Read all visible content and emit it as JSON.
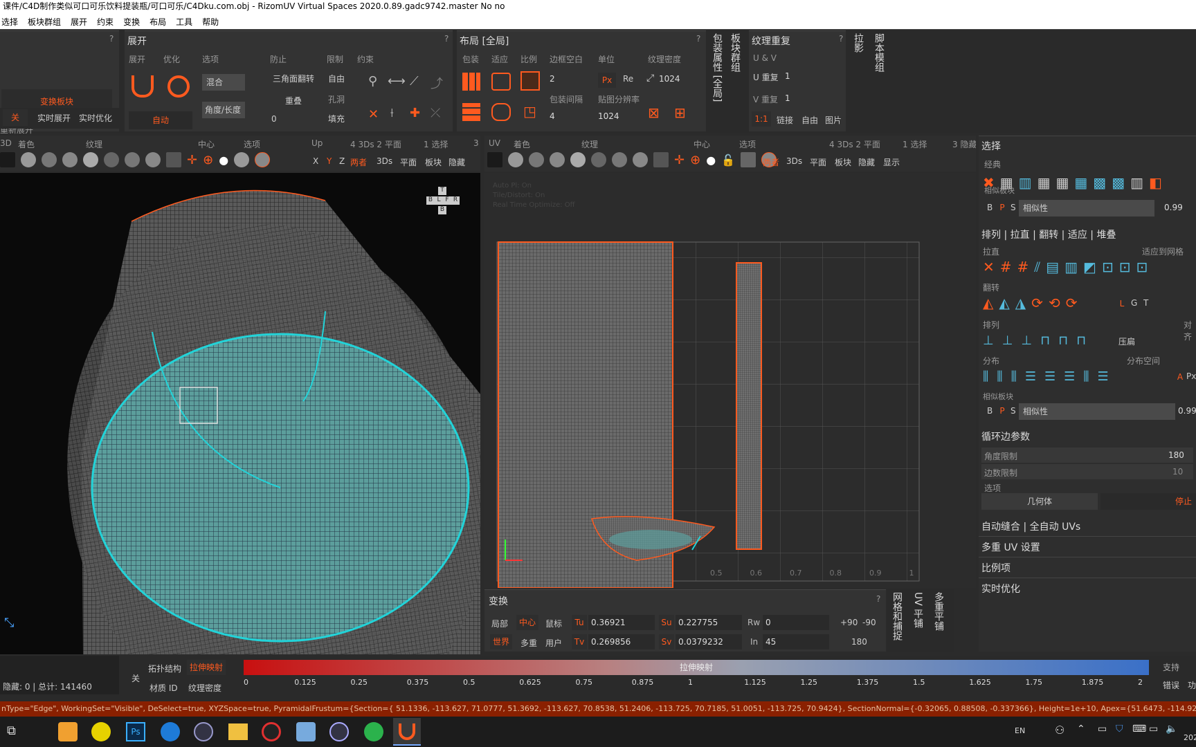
{
  "window": {
    "title": "课件/C4D制作类似可口可乐饮料提装瓶/可口可乐/C4Dku.com.obj - RizomUV  Virtual Spaces 2020.0.89.gadc9742.master No no"
  },
  "menu": [
    "选择",
    "板块群组",
    "展开",
    "约束",
    "变换",
    "布局",
    "工具",
    "帮助"
  ],
  "left_panel": {
    "btn_changeisland": "变换板块",
    "btn_reunfold": "重新展开",
    "btn_off": "关",
    "btn_realtime_unfold": "实时展开",
    "btn_realtime_opt": "实时优化"
  },
  "unfold": {
    "title": "展开",
    "tab_unfold": "展开",
    "tab_optimize": "优化",
    "tab_options": "选项",
    "tab_prevent": "防止",
    "tab_limit": "限制",
    "tab_constraint": "约束",
    "mix": "混合",
    "angle_length": "角度/长度",
    "triangle_flip": "三角面翻转",
    "overlap": "重叠",
    "free": "自由",
    "holes": "孔洞",
    "fill": "填充",
    "auto": "自动",
    "value0": "0"
  },
  "layout": {
    "title": "布局 [全局]",
    "pack": "包装",
    "fit": "适应",
    "scale": "比例",
    "margin": "边框空白",
    "unit": "单位",
    "tex_density": "纹理密度",
    "margin_val": "2",
    "spacing": "包装间隔",
    "spacing_val": "4",
    "px": "Px",
    "re": "Re",
    "density_val": "1024",
    "map_res": "贴图分辨率",
    "map_res_val": "1024"
  },
  "vtabs_top": [
    "包装属性 [全局]",
    "板块群组"
  ],
  "texrepeat": {
    "title": "纹理重复",
    "uv": "U & V",
    "u_repeat": "U 重复",
    "u_val": "1",
    "v_repeat": "V 重复",
    "v_val": "1",
    "ratio": "1:1",
    "link": "链接",
    "free": "自由",
    "image": "图片"
  },
  "vtabs_right": [
    "拉影",
    "脚本模组"
  ],
  "viewport3d": {
    "header": [
      "3D",
      "着色",
      "纹理",
      "中心",
      "选项",
      "Up",
      "4 3Ds 2 平面",
      "1 选择",
      "3"
    ],
    "tb": [
      "X",
      "Y",
      "Z",
      "两者",
      "3Ds",
      "平面",
      "板块",
      "隐藏"
    ],
    "cube": {
      "t": "T",
      "b": "B",
      "l": "L",
      "f": "F",
      "r": "R",
      "bb": "B"
    }
  },
  "viewportuv": {
    "header": [
      "UV",
      "着色",
      "纹理",
      "中心",
      "选项",
      "4 3Ds 2 平面",
      "1 选择",
      "3 隐藏"
    ],
    "tb": [
      "两者",
      "3Ds",
      "平面",
      "板块",
      "隐藏",
      "显示"
    ],
    "info": [
      "Auto Pl: On",
      "Tile/Distort: On",
      "Real Time Optimize: Off"
    ],
    "axis_ticks": [
      "0.5",
      "0.6",
      "0.7",
      "0.8",
      "0.9",
      "1"
    ]
  },
  "select": {
    "title": "选择",
    "classic": "经典",
    "similar": "相似板块",
    "b": "B",
    "p": "P",
    "s": "S",
    "similarity": "相似性",
    "sim_val": "0.99",
    "arrange_title": "排列 | 拉直 | 翻转 | 适应 | 堆叠",
    "straighten": "拉直",
    "fit_grid": "适应到网格",
    "flip": "翻转",
    "l": "L",
    "g": "G",
    "t": "T",
    "arrange": "排列",
    "align": "对齐",
    "compress": "压扁",
    "distribute": "分布",
    "dist_space": "分布空间",
    "a": "A",
    "px": "Px",
    "similar2": "相似板块",
    "sim_val2": "0.99"
  },
  "loop": {
    "title": "循环边参数",
    "angle_limit": "角度限制",
    "angle_val": "180",
    "edge_limit": "边数限制",
    "edge_val": "10",
    "options": "选项",
    "geometry": "几何体",
    "stop": "停止"
  },
  "right_links": [
    "自动缝合 | 全自动 UVs",
    "多重 UV 设置",
    "比例项",
    "实时优化"
  ],
  "transform": {
    "title": "变换",
    "local": "局部",
    "center": "中心",
    "mouse": "鼠标",
    "world": "世界",
    "multi": "多重",
    "user": "用户",
    "tu": "Tu",
    "tu_val": "0.36921",
    "tv": "Tv",
    "tv_val": "0.269856",
    "su": "Su",
    "su_val": "0.227755",
    "sv": "Sv",
    "sv_val": "0.0379232",
    "rw": "Rw",
    "rw_val": "0",
    "in": "In",
    "in_val": "45",
    "p90": "+90",
    "m90": "-90",
    "v180": "180"
  },
  "vtabs_bottom": [
    "网格和捕捉",
    "UV 平铺",
    "多重平铺"
  ],
  "bottombar": {
    "hidden": "隐藏: 0 | 总计: 141460",
    "off": "关",
    "topo": "拓扑结构",
    "stretch": "拉伸映射",
    "material": "材质 ID",
    "texdens": "纹理密度",
    "bar_label": "拉伸映射",
    "ticks": [
      "0",
      "0.125",
      "0.25",
      "0.375",
      "0.5",
      "0.625",
      "0.75",
      "0.875",
      "1",
      "1.125",
      "1.25",
      "1.375",
      "1.5",
      "1.625",
      "1.75",
      "1.875",
      "2"
    ],
    "support": "支持",
    "error": "错误",
    "fn": "功"
  },
  "cmdline": "nType=\"Edge\", WorkingSet=\"Visible\", DeSelect=true, XYZSpace=true, PyramidalFrustum={Section={ 51.1336, -113.627, 71.0777, 51.3692, -113.627, 70.8538, 51.2406, -113.725, 70.7185, 51.0051, -113.725, 70.9424}, SectionNormal={-0.32065, 0.88508, -0.337366}, Height=1e+10, Apex={51.6473, -114.92",
  "taskbar": {
    "lang": "EN",
    "year": "202"
  },
  "colors": {
    "accent": "#ff5a1f",
    "cyan": "#22d3d8",
    "panel": "#333333",
    "cmd": "#8a2000"
  }
}
